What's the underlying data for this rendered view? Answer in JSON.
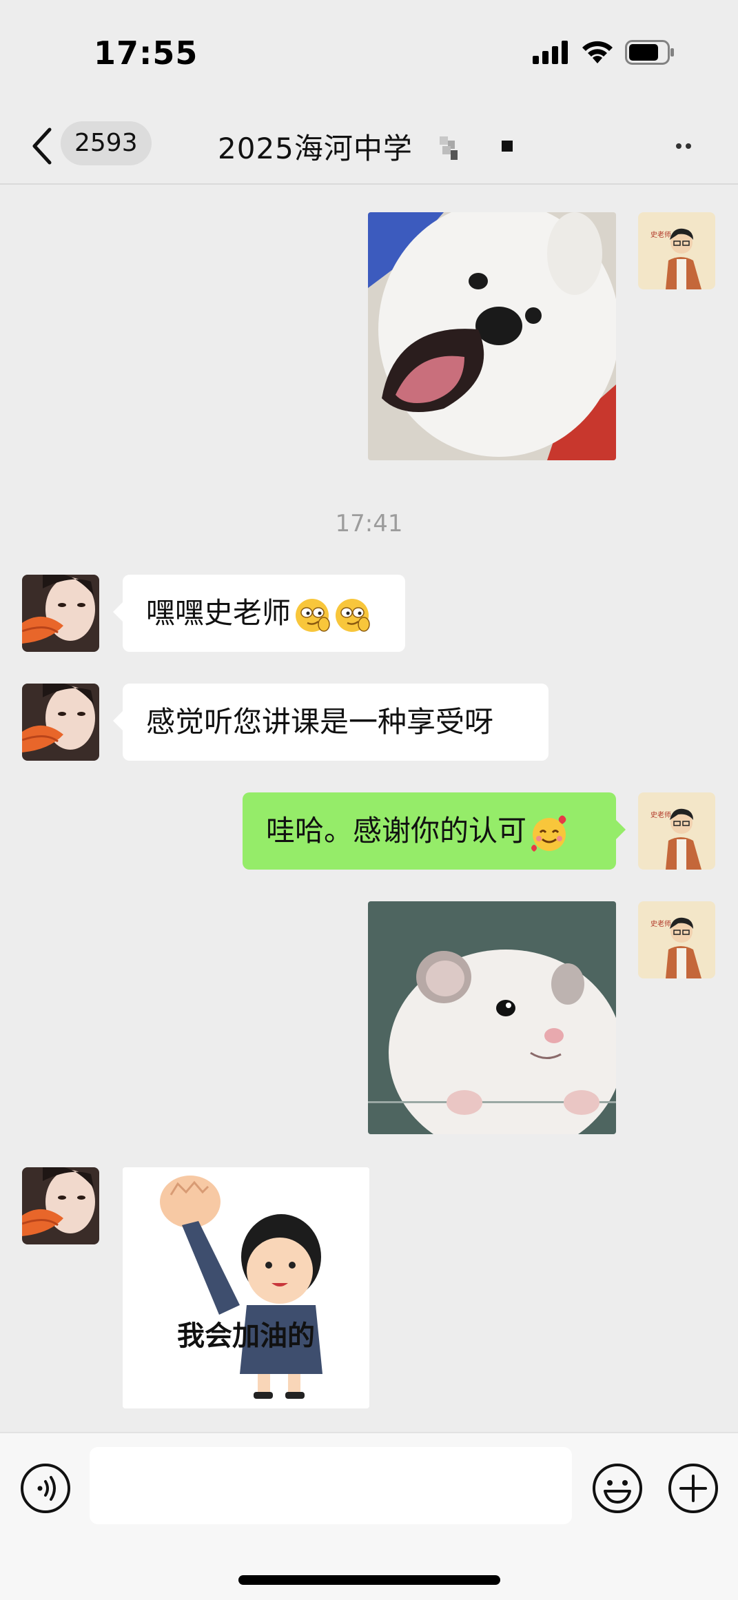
{
  "status_bar": {
    "time": "17:55",
    "icons": [
      "cellular-signal-icon",
      "wifi-icon",
      "battery-icon"
    ]
  },
  "navbar": {
    "back_icon": "chevron-left-icon",
    "unread_count": "2593",
    "title": "2025海河中学",
    "more_icon": "more-dots-icon"
  },
  "messages": [
    {
      "side": "right",
      "type": "image",
      "sender": "史老师",
      "content": "white-dog-sticker"
    },
    {
      "type": "timestamp",
      "text": "17:41"
    },
    {
      "side": "left",
      "type": "text",
      "text": "嘿嘿史老师",
      "emojis": [
        "smirk-emoji",
        "smirk-emoji"
      ]
    },
    {
      "side": "left",
      "type": "text",
      "text": "感觉听您讲课是一种享受呀"
    },
    {
      "side": "right",
      "type": "text",
      "sender": "史老师",
      "text": "哇哈。感谢你的认可",
      "emojis": [
        "smiling-hearts-emoji"
      ]
    },
    {
      "side": "right",
      "type": "image",
      "sender": "史老师",
      "content": "hamster-sticker"
    },
    {
      "side": "left",
      "type": "image",
      "content": "cheer-sticker",
      "caption": "我会加油的"
    }
  ],
  "avatars": {
    "teacher_label": "史老师"
  },
  "input_bar": {
    "placeholder": "",
    "icons": [
      "voice-icon",
      "emoji-icon",
      "plus-icon"
    ]
  },
  "colors": {
    "background": "#EDEDED",
    "own_bubble": "#95EC69",
    "other_bubble": "#FFFFFF",
    "timestamp": "#9C9C9C"
  }
}
